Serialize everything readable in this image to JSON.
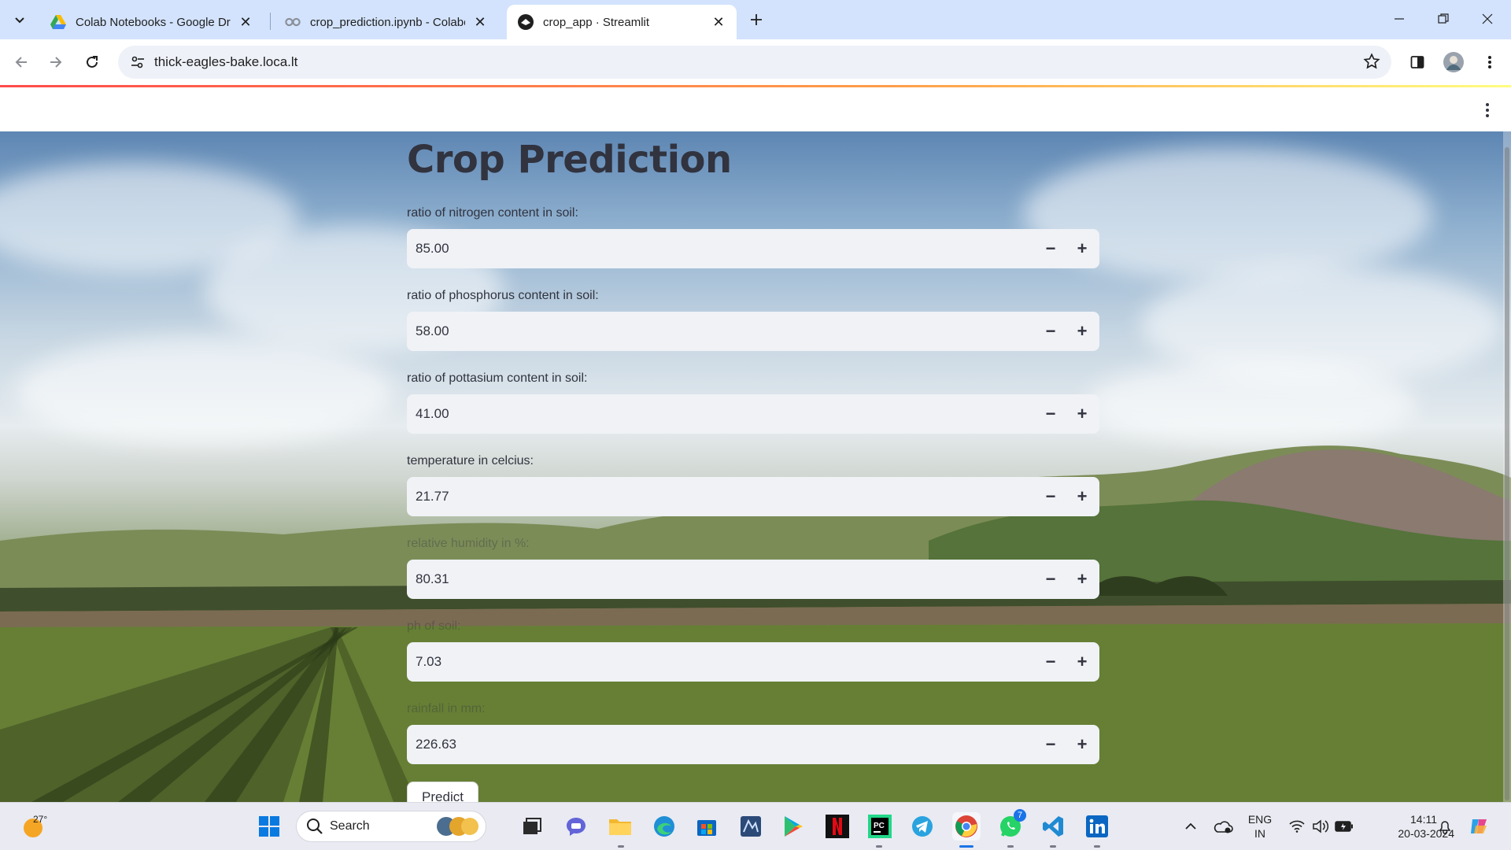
{
  "browser": {
    "tabs": [
      {
        "title": "Colab Notebooks - Google Drive",
        "icon": "google-drive-icon",
        "active": false
      },
      {
        "title": "crop_prediction.ipynb - Colaboratory",
        "icon": "colab-icon",
        "active": false
      },
      {
        "title": "crop_app · Streamlit",
        "icon": "streamlit-icon",
        "active": true
      }
    ],
    "url": "thick-eagles-bake.loca.lt"
  },
  "app": {
    "title": "Crop Prediction",
    "fields": [
      {
        "label": "ratio of nitrogen content in soil:",
        "value": "85.00"
      },
      {
        "label": "ratio of phosphorus content in soil:",
        "value": "58.00"
      },
      {
        "label": "ratio of pottasium content in soil:",
        "value": "41.00"
      },
      {
        "label": "temperature in celcius:",
        "value": "21.77"
      },
      {
        "label": "relative humidity in %:",
        "value": "80.31"
      },
      {
        "label": "ph of soil:",
        "value": "7.03"
      },
      {
        "label": "rainfall in mm:",
        "value": "226.63"
      }
    ],
    "predict_label": "Predict",
    "accent_color": "#ff4b4b"
  },
  "taskbar": {
    "weather_temp": "27°",
    "search_placeholder": "Search",
    "whatsapp_badge": "7",
    "lang_line1": "ENG",
    "lang_line2": "IN",
    "time": "14:11",
    "date": "20-03-2024"
  }
}
